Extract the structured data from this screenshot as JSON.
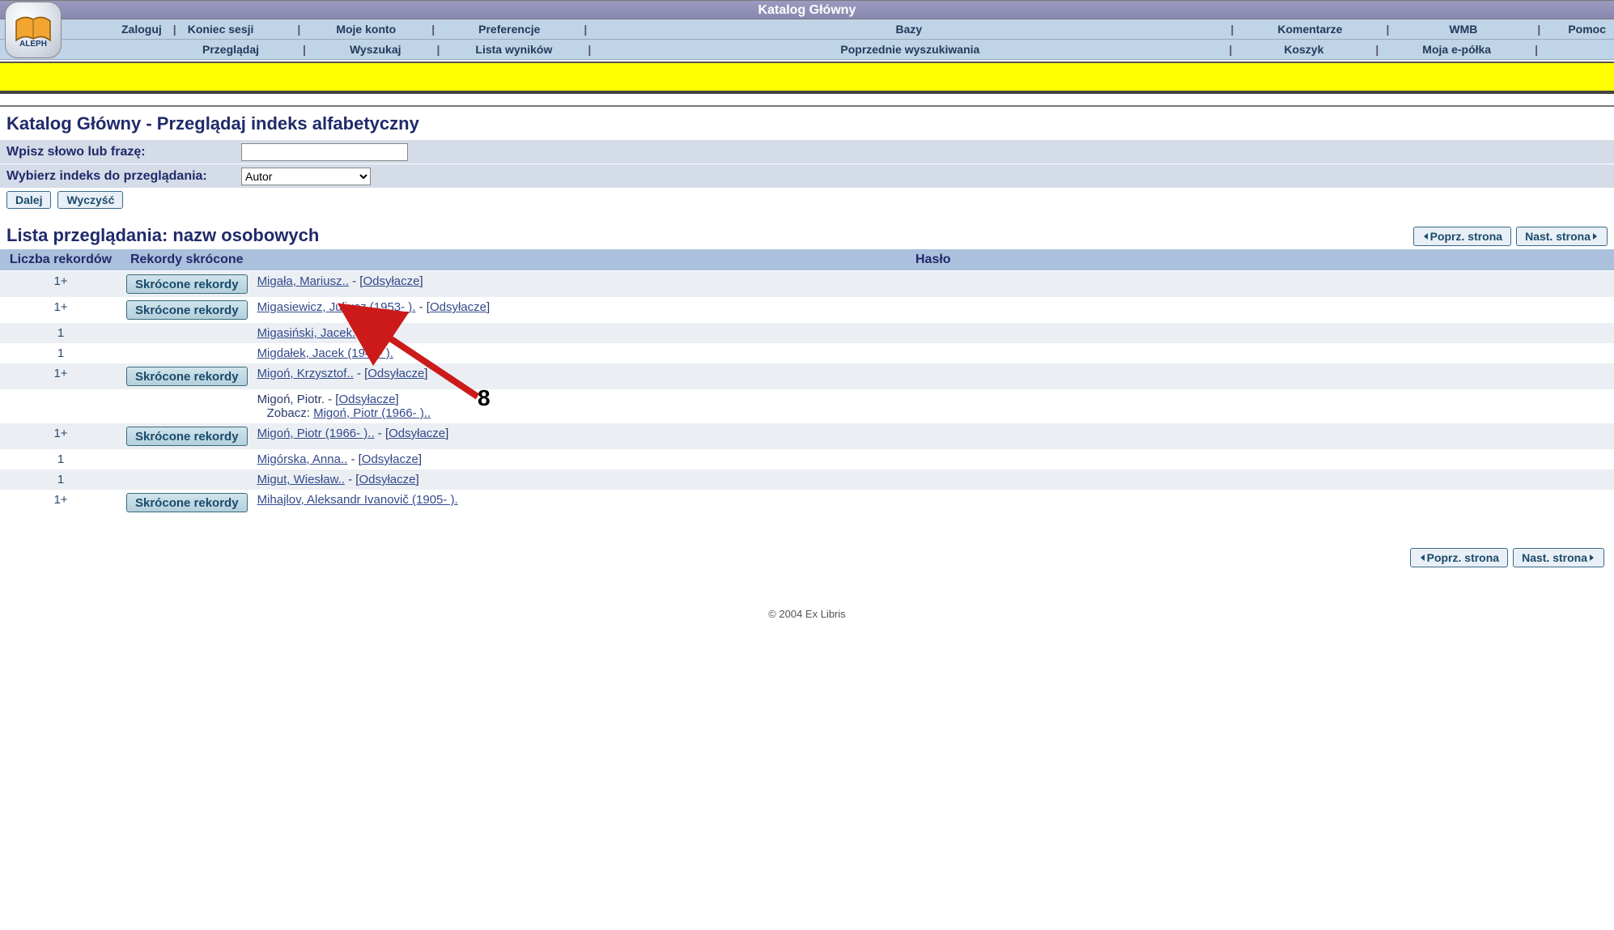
{
  "header": {
    "title": "Katalog Główny",
    "logo_alt": "ALEPH"
  },
  "nav": {
    "row1": [
      "Zaloguj",
      "Koniec sesji",
      "Moje konto",
      "Preferencje",
      "Bazy",
      "Komentarze",
      "WMB",
      "Pomoc"
    ],
    "row2": [
      "Przeglądaj",
      "Wyszukaj",
      "Lista wyników",
      "Poprzednie wyszukiwania",
      "Koszyk",
      "Moja e-półka"
    ]
  },
  "page": {
    "title": "Katalog Główny - Przeglądaj indeks alfabetyczny",
    "form": {
      "phrase_label": "Wpisz słowo lub frazę:",
      "phrase_value": "",
      "index_label": "Wybierz indeks do przeglądania:",
      "index_value": "Autor"
    },
    "buttons": {
      "go": "Dalej",
      "clear": "Wyczyść"
    }
  },
  "list": {
    "title": "Lista przeglądania: nazw osobowych",
    "pager_prev": "Poprz. strona",
    "pager_next": "Nast. strona",
    "columns": {
      "count": "Liczba rekordów",
      "short": "Rekordy skrócone",
      "heading": "Hasło"
    },
    "short_button": "Skrócone rekordy",
    "ref_label": "Odsyłacze",
    "see_label": "Zobacz:",
    "rows": [
      {
        "count": "1+",
        "short": true,
        "heading": "Migała, Mariusz..",
        "refs": true
      },
      {
        "count": "1+",
        "short": true,
        "heading": "Migasiewicz, Juliusz (1953- ).",
        "refs": true
      },
      {
        "count": "1",
        "short": false,
        "heading": "Migasiński, Jacek."
      },
      {
        "count": "1",
        "short": false,
        "heading": "Migdałek, Jacek (1949- )."
      },
      {
        "count": "1+",
        "short": true,
        "heading": "Migoń, Krzysztof..",
        "refs": true
      },
      {
        "count": "",
        "short": false,
        "heading_plain": "Migoń, Piotr.",
        "refs": true,
        "see": "Migoń, Piotr (1966- ).."
      },
      {
        "count": "1+",
        "short": true,
        "heading": "Migoń, Piotr (1966- )..",
        "refs": true
      },
      {
        "count": "1",
        "short": false,
        "heading": "Migórska, Anna..",
        "refs": true
      },
      {
        "count": "1",
        "short": false,
        "heading": "Migut, Wiesław..",
        "refs": true
      },
      {
        "count": "1+",
        "short": true,
        "heading": "Mihajlov, Aleksandr Ivanovič (1905- )."
      }
    ]
  },
  "annotation": {
    "label": "8"
  },
  "footer": {
    "copyright": "© 2004 Ex Libris"
  }
}
